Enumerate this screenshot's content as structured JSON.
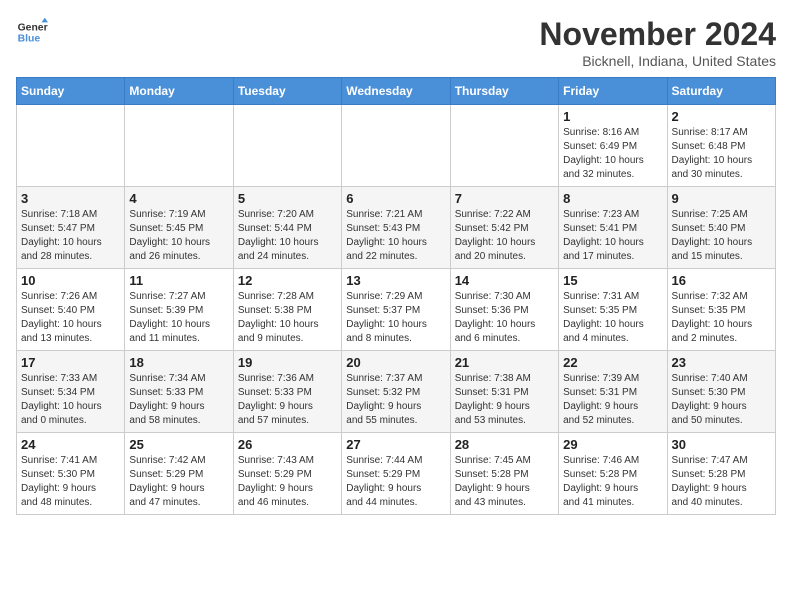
{
  "logo": {
    "line1": "General",
    "line2": "Blue"
  },
  "title": "November 2024",
  "location": "Bicknell, Indiana, United States",
  "weekdays": [
    "Sunday",
    "Monday",
    "Tuesday",
    "Wednesday",
    "Thursday",
    "Friday",
    "Saturday"
  ],
  "weeks": [
    [
      {
        "day": "",
        "info": ""
      },
      {
        "day": "",
        "info": ""
      },
      {
        "day": "",
        "info": ""
      },
      {
        "day": "",
        "info": ""
      },
      {
        "day": "",
        "info": ""
      },
      {
        "day": "1",
        "info": "Sunrise: 8:16 AM\nSunset: 6:49 PM\nDaylight: 10 hours\nand 32 minutes."
      },
      {
        "day": "2",
        "info": "Sunrise: 8:17 AM\nSunset: 6:48 PM\nDaylight: 10 hours\nand 30 minutes."
      }
    ],
    [
      {
        "day": "3",
        "info": "Sunrise: 7:18 AM\nSunset: 5:47 PM\nDaylight: 10 hours\nand 28 minutes."
      },
      {
        "day": "4",
        "info": "Sunrise: 7:19 AM\nSunset: 5:45 PM\nDaylight: 10 hours\nand 26 minutes."
      },
      {
        "day": "5",
        "info": "Sunrise: 7:20 AM\nSunset: 5:44 PM\nDaylight: 10 hours\nand 24 minutes."
      },
      {
        "day": "6",
        "info": "Sunrise: 7:21 AM\nSunset: 5:43 PM\nDaylight: 10 hours\nand 22 minutes."
      },
      {
        "day": "7",
        "info": "Sunrise: 7:22 AM\nSunset: 5:42 PM\nDaylight: 10 hours\nand 20 minutes."
      },
      {
        "day": "8",
        "info": "Sunrise: 7:23 AM\nSunset: 5:41 PM\nDaylight: 10 hours\nand 17 minutes."
      },
      {
        "day": "9",
        "info": "Sunrise: 7:25 AM\nSunset: 5:40 PM\nDaylight: 10 hours\nand 15 minutes."
      }
    ],
    [
      {
        "day": "10",
        "info": "Sunrise: 7:26 AM\nSunset: 5:40 PM\nDaylight: 10 hours\nand 13 minutes."
      },
      {
        "day": "11",
        "info": "Sunrise: 7:27 AM\nSunset: 5:39 PM\nDaylight: 10 hours\nand 11 minutes."
      },
      {
        "day": "12",
        "info": "Sunrise: 7:28 AM\nSunset: 5:38 PM\nDaylight: 10 hours\nand 9 minutes."
      },
      {
        "day": "13",
        "info": "Sunrise: 7:29 AM\nSunset: 5:37 PM\nDaylight: 10 hours\nand 8 minutes."
      },
      {
        "day": "14",
        "info": "Sunrise: 7:30 AM\nSunset: 5:36 PM\nDaylight: 10 hours\nand 6 minutes."
      },
      {
        "day": "15",
        "info": "Sunrise: 7:31 AM\nSunset: 5:35 PM\nDaylight: 10 hours\nand 4 minutes."
      },
      {
        "day": "16",
        "info": "Sunrise: 7:32 AM\nSunset: 5:35 PM\nDaylight: 10 hours\nand 2 minutes."
      }
    ],
    [
      {
        "day": "17",
        "info": "Sunrise: 7:33 AM\nSunset: 5:34 PM\nDaylight: 10 hours\nand 0 minutes."
      },
      {
        "day": "18",
        "info": "Sunrise: 7:34 AM\nSunset: 5:33 PM\nDaylight: 9 hours\nand 58 minutes."
      },
      {
        "day": "19",
        "info": "Sunrise: 7:36 AM\nSunset: 5:33 PM\nDaylight: 9 hours\nand 57 minutes."
      },
      {
        "day": "20",
        "info": "Sunrise: 7:37 AM\nSunset: 5:32 PM\nDaylight: 9 hours\nand 55 minutes."
      },
      {
        "day": "21",
        "info": "Sunrise: 7:38 AM\nSunset: 5:31 PM\nDaylight: 9 hours\nand 53 minutes."
      },
      {
        "day": "22",
        "info": "Sunrise: 7:39 AM\nSunset: 5:31 PM\nDaylight: 9 hours\nand 52 minutes."
      },
      {
        "day": "23",
        "info": "Sunrise: 7:40 AM\nSunset: 5:30 PM\nDaylight: 9 hours\nand 50 minutes."
      }
    ],
    [
      {
        "day": "24",
        "info": "Sunrise: 7:41 AM\nSunset: 5:30 PM\nDaylight: 9 hours\nand 48 minutes."
      },
      {
        "day": "25",
        "info": "Sunrise: 7:42 AM\nSunset: 5:29 PM\nDaylight: 9 hours\nand 47 minutes."
      },
      {
        "day": "26",
        "info": "Sunrise: 7:43 AM\nSunset: 5:29 PM\nDaylight: 9 hours\nand 46 minutes."
      },
      {
        "day": "27",
        "info": "Sunrise: 7:44 AM\nSunset: 5:29 PM\nDaylight: 9 hours\nand 44 minutes."
      },
      {
        "day": "28",
        "info": "Sunrise: 7:45 AM\nSunset: 5:28 PM\nDaylight: 9 hours\nand 43 minutes."
      },
      {
        "day": "29",
        "info": "Sunrise: 7:46 AM\nSunset: 5:28 PM\nDaylight: 9 hours\nand 41 minutes."
      },
      {
        "day": "30",
        "info": "Sunrise: 7:47 AM\nSunset: 5:28 PM\nDaylight: 9 hours\nand 40 minutes."
      }
    ]
  ]
}
